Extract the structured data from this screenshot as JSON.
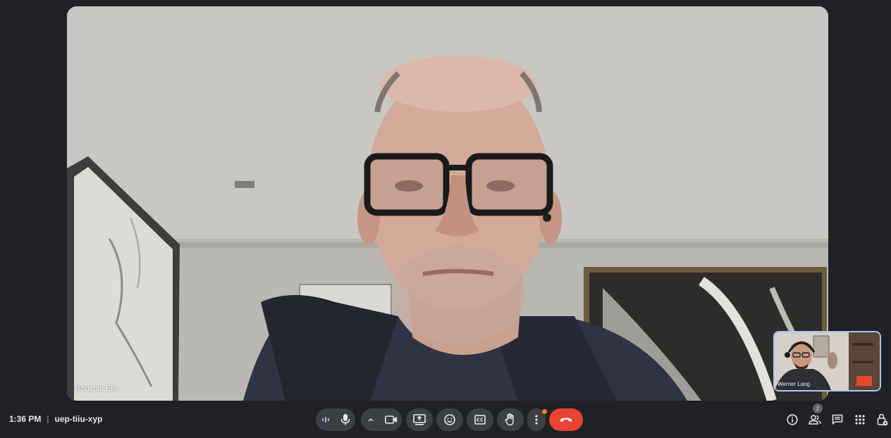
{
  "main_participant": {
    "name": "Gonzalo Elio"
  },
  "self_view": {
    "name": "Werner Lang"
  },
  "meeting": {
    "time": "1:36 PM",
    "separator": "|",
    "code": "uep-tiiu-xyp"
  },
  "controls": [
    "audio-level-icon",
    "microphone-icon",
    "chevron-up-icon",
    "camera-icon",
    "present-screen-icon",
    "emoji-icon",
    "captions-icon",
    "raise-hand-icon",
    "more-options-icon",
    "hang-up-icon"
  ],
  "right_controls": {
    "people_count": "2",
    "icons": [
      "info-icon",
      "people-icon",
      "chat-icon",
      "activities-icon",
      "host-controls-icon"
    ]
  },
  "colors": {
    "background": "#202124",
    "control_bg": "#3c4043",
    "hangup": "#ea4335",
    "notification_dot": "#fa7b17",
    "self_border": "#a8c7fa"
  }
}
